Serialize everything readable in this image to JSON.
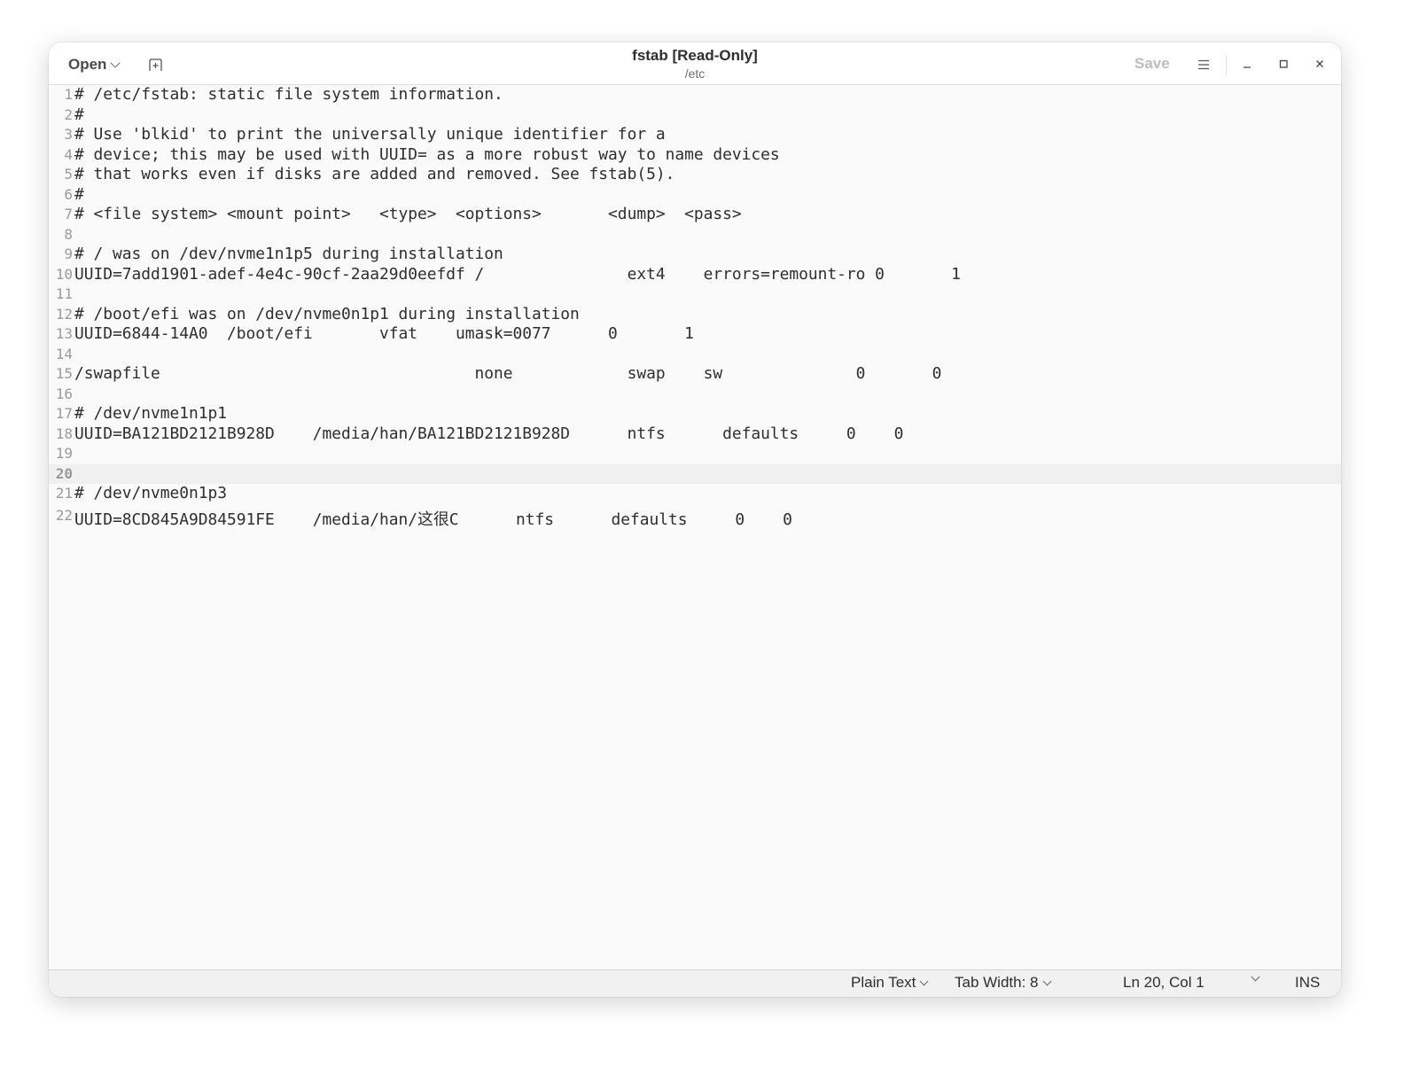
{
  "header": {
    "open_label": "Open",
    "title": "fstab [Read-Only]",
    "subtitle": "/etc",
    "save_label": "Save"
  },
  "editor": {
    "current_line": 20,
    "lines": [
      {
        "n": "1",
        "text": "# /etc/fstab: static file system information."
      },
      {
        "n": "2",
        "text": "#"
      },
      {
        "n": "3",
        "text": "# Use 'blkid' to print the universally unique identifier for a"
      },
      {
        "n": "4",
        "text": "# device; this may be used with UUID= as a more robust way to name devices"
      },
      {
        "n": "5",
        "text": "# that works even if disks are added and removed. See fstab(5)."
      },
      {
        "n": "6",
        "text": "#"
      },
      {
        "n": "7",
        "text": "# <file system> <mount point>   <type>  <options>       <dump>  <pass>"
      },
      {
        "n": "8",
        "text": ""
      },
      {
        "n": "9",
        "text": "# / was on /dev/nvme1n1p5 during installation"
      },
      {
        "n": "10",
        "text": "UUID=7add1901-adef-4e4c-90cf-2aa29d0eefdf /               ext4    errors=remount-ro 0       1"
      },
      {
        "n": "11",
        "text": ""
      },
      {
        "n": "12",
        "text": "# /boot/efi was on /dev/nvme0n1p1 during installation"
      },
      {
        "n": "13",
        "text": "UUID=6844-14A0  /boot/efi       vfat    umask=0077      0       1"
      },
      {
        "n": "14",
        "text": ""
      },
      {
        "n": "15",
        "text": "/swapfile                                 none            swap    sw              0       0"
      },
      {
        "n": "16",
        "text": ""
      },
      {
        "n": "17",
        "text": "# /dev/nvme1n1p1"
      },
      {
        "n": "18",
        "text": "UUID=BA121BD2121B928D    /media/han/BA121BD2121B928D      ntfs      defaults     0    0"
      },
      {
        "n": "19",
        "text": ""
      },
      {
        "n": "20",
        "text": ""
      },
      {
        "n": "21",
        "text": "# /dev/nvme0n1p3"
      },
      {
        "n": "22",
        "text": "UUID=8CD845A9D84591FE    /media/han/这很C      ntfs      defaults     0    0"
      }
    ]
  },
  "statusbar": {
    "language": "Plain Text",
    "tab_width": "Tab Width: 8",
    "position": "Ln 20, Col 1",
    "mode": "INS"
  }
}
